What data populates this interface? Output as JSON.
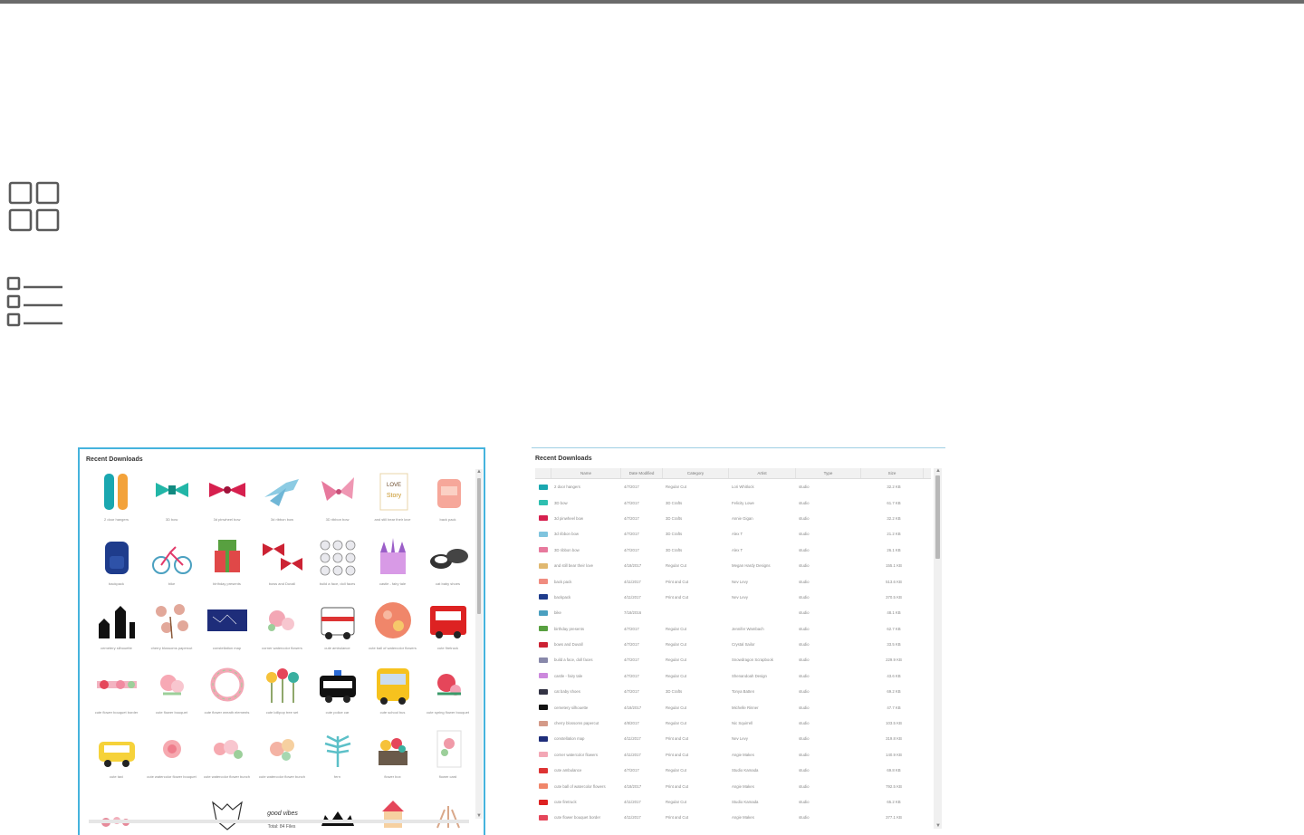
{
  "colors": {
    "topbar": "#6b6b6b",
    "panel_border": "#45b3dd",
    "icon_stroke": "#5a5a5a"
  },
  "view_toggle": {
    "grid_icon": "grid-view-icon",
    "list_icon": "list-view-icon"
  },
  "grid_panel": {
    "title": "Recent Downloads",
    "footer": "Total: 84 Files",
    "items": [
      {
        "label": "2 door hangers",
        "art": "tags"
      },
      {
        "label": "3D bow",
        "art": "bow-teal"
      },
      {
        "label": "3d pinwheel bow",
        "art": "bow-pink"
      },
      {
        "label": "3d ribbon bow",
        "art": "bow-blue"
      },
      {
        "label": "3D ribbon bow",
        "art": "bow-rose"
      },
      {
        "label": "and still bear their love",
        "art": "quote"
      },
      {
        "label": "back pack",
        "art": "bag"
      },
      {
        "label": "backpack",
        "art": "backpack"
      },
      {
        "label": "bike",
        "art": "bike"
      },
      {
        "label": "birthday presents",
        "art": "gifts"
      },
      {
        "label": "bows and Duvall",
        "art": "bows-red"
      },
      {
        "label": "build a face, doll faces",
        "art": "faces"
      },
      {
        "label": "castle - fairy tale",
        "art": "castle"
      },
      {
        "label": "cat baby shoes",
        "art": "shoes"
      },
      {
        "label": "cemetery silhouette",
        "art": "cemetery"
      },
      {
        "label": "cherry blossoms papercut",
        "art": "blossom"
      },
      {
        "label": "constellation map",
        "art": "map"
      },
      {
        "label": "corner watercolor flowers",
        "art": "flowers"
      },
      {
        "label": "cute ambulance",
        "art": "ambulance"
      },
      {
        "label": "cute ball of watercolor flowers",
        "art": "ball"
      },
      {
        "label": "cute firetruck",
        "art": "firetruck"
      },
      {
        "label": "cute flower bouquet border",
        "art": "border"
      },
      {
        "label": "cute flower bouquet",
        "art": "bouquet"
      },
      {
        "label": "cute flower wreath elements",
        "art": "wreath"
      },
      {
        "label": "cute lollipop tree set",
        "art": "lollipop"
      },
      {
        "label": "cute police car",
        "art": "police"
      },
      {
        "label": "cute school bus",
        "art": "bus"
      },
      {
        "label": "cute spring flower bouquet",
        "art": "spring"
      },
      {
        "label": "cute taxi",
        "art": "taxi"
      },
      {
        "label": "cute watercolor flower bouquet",
        "art": "rose"
      },
      {
        "label": "cute watercolor flower bunch",
        "art": "bunch"
      },
      {
        "label": "cute watercolor flower bunch",
        "art": "bunch2"
      },
      {
        "label": "fern",
        "art": "fern"
      },
      {
        "label": "flower box",
        "art": "box"
      },
      {
        "label": "flower card",
        "art": "card"
      },
      {
        "label": "",
        "art": "flowerline"
      },
      {
        "label": "",
        "art": "blank"
      },
      {
        "label": "",
        "art": "fox"
      },
      {
        "label": "",
        "art": "script"
      },
      {
        "label": "",
        "art": "crown"
      },
      {
        "label": "",
        "art": "carousel"
      },
      {
        "label": "",
        "art": "sprigs"
      }
    ]
  },
  "list_panel": {
    "title": "Recent Downloads",
    "columns": [
      "Name",
      "Date Modified",
      "Category",
      "Artist",
      "Type",
      "Size"
    ],
    "rows": [
      {
        "name": "2 door hangers",
        "date": "4/7/2017",
        "category": "Regular Cut",
        "artist": "Lori Whitlock",
        "type": "studio",
        "size": "32.2 KB",
        "color": "#1aa7b0"
      },
      {
        "name": "3D bow",
        "date": "4/7/2017",
        "category": "3D Crafts",
        "artist": "Felicity Lowe",
        "type": "studio",
        "size": "61.7 KB",
        "color": "#2ebfb0"
      },
      {
        "name": "3d pinwheel bow",
        "date": "4/7/2017",
        "category": "3D Crafts",
        "artist": "Annie Gigan",
        "type": "studio",
        "size": "32.2 KB",
        "color": "#d6204e"
      },
      {
        "name": "3d ribbon bow",
        "date": "4/7/2017",
        "category": "3D Crafts",
        "artist": "Alex T",
        "type": "studio",
        "size": "21.2 KB",
        "color": "#7fc4de"
      },
      {
        "name": "3D ribbon bow",
        "date": "4/7/2017",
        "category": "3D Crafts",
        "artist": "Alex T",
        "type": "studio",
        "size": "26.1 KB",
        "color": "#e7799d"
      },
      {
        "name": "and still bear their love",
        "date": "4/18/2017",
        "category": "Regular Cut",
        "artist": "Megan Hardy Designs",
        "type": "studio",
        "size": "155.1 KB",
        "color": "#e0b870"
      },
      {
        "name": "back pack",
        "date": "4/11/2017",
        "category": "Print and Cut",
        "artist": "Nev Levy",
        "type": "studio",
        "size": "513.6 KB",
        "color": "#f08c80"
      },
      {
        "name": "backpack",
        "date": "4/11/2017",
        "category": "Print and Cut",
        "artist": "Nev Levy",
        "type": "studio",
        "size": "370.5 KB",
        "color": "#1e3c8c"
      },
      {
        "name": "bike",
        "date": "7/18/2016",
        "category": "",
        "artist": "",
        "type": "studio",
        "size": "48.1 KB",
        "color": "#4aa0c0"
      },
      {
        "name": "birthday presents",
        "date": "4/7/2017",
        "category": "Regular Cut",
        "artist": "Jennifer Wambach",
        "type": "studio",
        "size": "62.7 KB",
        "color": "#58a040"
      },
      {
        "name": "bows and Duvall",
        "date": "4/7/2017",
        "category": "Regular Cut",
        "artist": "Crystal Sailor",
        "type": "studio",
        "size": "33.5 KB",
        "color": "#cc2233"
      },
      {
        "name": "build a face, doll faces",
        "date": "4/7/2017",
        "category": "Regular Cut",
        "artist": "Snowdragon Scrapbook",
        "type": "studio",
        "size": "229.9 KB",
        "color": "#8888aa"
      },
      {
        "name": "castle - fairy tale",
        "date": "4/7/2017",
        "category": "Regular Cut",
        "artist": "Shenandoah Design",
        "type": "studio",
        "size": "43.6 KB",
        "color": "#cc88dd"
      },
      {
        "name": "cat baby shoes",
        "date": "4/7/2017",
        "category": "3D Crafts",
        "artist": "Tonya Batten",
        "type": "studio",
        "size": "69.2 KB",
        "color": "#333344"
      },
      {
        "name": "cemetery silhouette",
        "date": "4/18/2017",
        "category": "Regular Cut",
        "artist": "Michelle Rinner",
        "type": "studio",
        "size": "47.7 KB",
        "color": "#111111"
      },
      {
        "name": "cherry blossoms papercut",
        "date": "4/8/2017",
        "category": "Regular Cut",
        "artist": "Nic Squirrell",
        "type": "studio",
        "size": "103.5 KB",
        "color": "#d49a88"
      },
      {
        "name": "constellation map",
        "date": "4/11/2017",
        "category": "Print and Cut",
        "artist": "Nev Levy",
        "type": "studio",
        "size": "319.8 KB",
        "color": "#1e2d7a"
      },
      {
        "name": "corner watercolor flowers",
        "date": "4/11/2017",
        "category": "Print and Cut",
        "artist": "Angie Makes",
        "type": "studio",
        "size": "140.9 KB",
        "color": "#f3a7b5"
      },
      {
        "name": "cute ambulance",
        "date": "4/7/2017",
        "category": "Regular Cut",
        "artist": "Studio Kamada",
        "type": "studio",
        "size": "69.8 KB",
        "color": "#d33"
      },
      {
        "name": "cute ball of watercolor flowers",
        "date": "4/18/2017",
        "category": "Print and Cut",
        "artist": "Angie Makes",
        "type": "studio",
        "size": "792.5 KB",
        "color": "#f0866a"
      },
      {
        "name": "cute firetruck",
        "date": "4/11/2017",
        "category": "Regular Cut",
        "artist": "Studio Kamada",
        "type": "studio",
        "size": "65.2 KB",
        "color": "#d22"
      },
      {
        "name": "cute flower bouquet border",
        "date": "4/11/2017",
        "category": "Print and Cut",
        "artist": "Angie Makes",
        "type": "studio",
        "size": "377.1 KB",
        "color": "#e5465a"
      }
    ]
  }
}
